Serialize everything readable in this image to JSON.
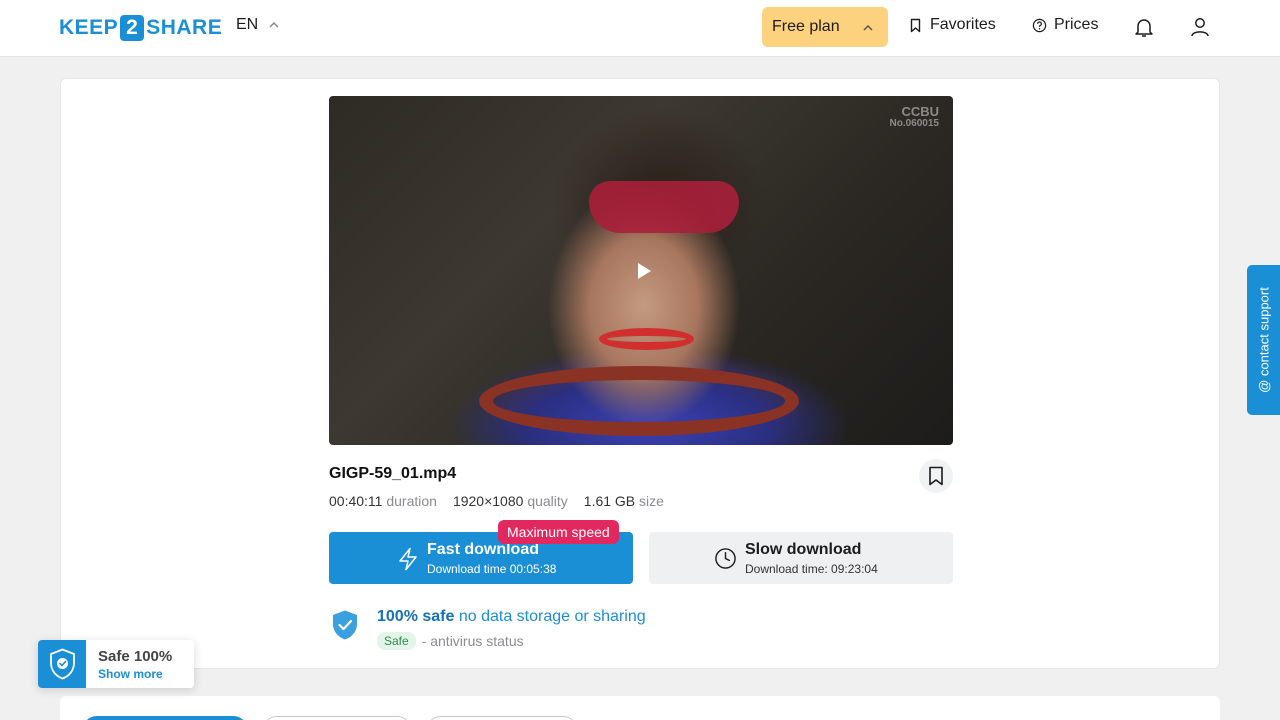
{
  "header": {
    "logo_left": "KEEP",
    "logo_mid": "2",
    "logo_right": "SHARE",
    "language": "EN",
    "plan_label": "Free plan",
    "favorites_label": "Favorites",
    "prices_label": "Prices",
    "icons": {
      "notifications": "bell-icon",
      "account": "user-icon"
    }
  },
  "video": {
    "watermark_line1": "CCBU",
    "watermark_line2": "No.060015"
  },
  "file": {
    "name": "GIGP-59_01.mp4",
    "duration_value": "00:40:11",
    "duration_label": "duration",
    "quality_value": "1920×1080",
    "quality_label": "quality",
    "size_value": "1.61 GB",
    "size_label": "size"
  },
  "download": {
    "fast_title": "Fast download",
    "fast_sub": "Download time 00:05:38",
    "max_badge": "Maximum speed",
    "slow_title": "Slow download",
    "slow_sub": "Download time: 09:23:04"
  },
  "safety": {
    "headline_bold": "100% safe",
    "headline_rest": " no data storage or sharing",
    "chip": "Safe",
    "status_text": "- antivirus status"
  },
  "support": {
    "label": "@ contact support"
  },
  "safe_widget": {
    "title": "Safe 100%",
    "more": "Show more"
  },
  "colors": {
    "brand": "#1b8fd6",
    "plan": "#fcd27f",
    "badge": "#e2295f",
    "background": "#f0f0f1"
  }
}
